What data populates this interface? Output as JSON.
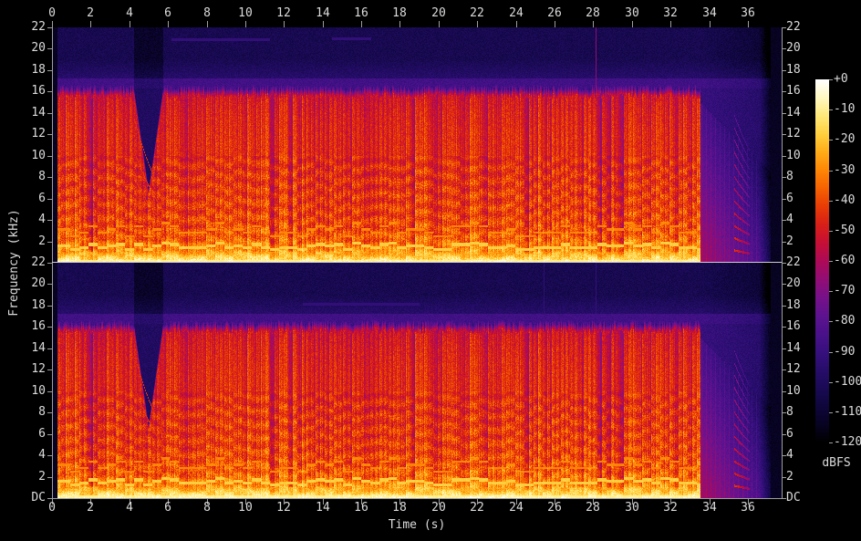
{
  "figure": {
    "xlabel": "Time (s)",
    "ylabel": "Frequency (kHz)",
    "colorbar_label": "dBFS",
    "background": "#000000",
    "axis_color": "#9e9e9e",
    "separator_color": "#cfcfcf",
    "text_color": "#dcdcdc"
  },
  "chart_data": {
    "type": "heatmap",
    "subtype": "audio-spectrogram-stereo",
    "channels": [
      "upper",
      "lower"
    ],
    "x": {
      "label": "Time (s)",
      "min": 0,
      "max": 37.75,
      "tick_values": [
        0,
        2,
        4,
        6,
        8,
        10,
        12,
        14,
        16,
        18,
        20,
        22,
        24,
        26,
        28,
        30,
        32,
        34,
        36
      ],
      "tick_labels": [
        "0",
        "2",
        "4",
        "6",
        "8",
        "10",
        "12",
        "14",
        "16",
        "18",
        "20",
        "22",
        "24",
        "26",
        "28",
        "30",
        "32",
        "34",
        "36"
      ]
    },
    "y": {
      "label": "Frequency (kHz)",
      "min": 0,
      "max": 22,
      "tick_values": [
        22,
        20,
        18,
        16,
        14,
        12,
        10,
        8,
        6,
        4,
        2
      ],
      "tick_labels": [
        "22",
        "20",
        "18",
        "16",
        "14",
        "12",
        "10",
        "8",
        "6",
        "4",
        "2"
      ],
      "dc_label": "DC"
    },
    "colorbar": {
      "label": "dBFS",
      "min": -120,
      "max": 0,
      "tick_labels": [
        "+0",
        "-10",
        "-20",
        "-30",
        "-40",
        "-50",
        "-60",
        "-70",
        "-80",
        "-90",
        "-100",
        "-110",
        "-120"
      ],
      "palette": [
        [
          -120,
          "#000000"
        ],
        [
          -114,
          "#070322"
        ],
        [
          -108,
          "#0f063c"
        ],
        [
          -102,
          "#1a0a55"
        ],
        [
          -96,
          "#270d6b"
        ],
        [
          -90,
          "#37107e"
        ],
        [
          -84,
          "#4a118a"
        ],
        [
          -78,
          "#5e128f"
        ],
        [
          -72,
          "#771189"
        ],
        [
          -66,
          "#920d74"
        ],
        [
          -60,
          "#ad0a56"
        ],
        [
          -54,
          "#c60f35"
        ],
        [
          -48,
          "#d81f17"
        ],
        [
          -42,
          "#e83b05"
        ],
        [
          -36,
          "#f66102"
        ],
        [
          -30,
          "#ff8605"
        ],
        [
          -24,
          "#ffab18"
        ],
        [
          -18,
          "#ffcf3e"
        ],
        [
          -12,
          "#ffe878"
        ],
        [
          -6,
          "#fff8c0"
        ],
        [
          0,
          "#ffffff"
        ]
      ]
    },
    "content": {
      "silence_lead_s": 0.28,
      "music_end_s": 33.55,
      "tail_end_s": 37.2,
      "duration_s": 37.75,
      "bandwidth_khz": 15.6,
      "noise_floor_db": -103,
      "noise_band": {
        "f0": 16.3,
        "f1": 17.2,
        "level_db": -87
      },
      "band_anchors": [
        [
          0,
          -8
        ],
        [
          0.25,
          -12
        ],
        [
          0.7,
          -20
        ],
        [
          1.2,
          -27
        ],
        [
          2,
          -33
        ],
        [
          3,
          -37
        ],
        [
          4.5,
          -40
        ],
        [
          6.5,
          -42
        ],
        [
          9,
          -44
        ],
        [
          12,
          -45
        ],
        [
          14,
          -47
        ],
        [
          15.6,
          -50
        ]
      ],
      "beat_period_s": 0.235,
      "melody": {
        "step_s": 0.47,
        "base_khz": 1.25,
        "range_khz": 0.6,
        "level_db": -16
      },
      "bass_level_db": -8,
      "notch": {
        "t0": 4.25,
        "t1": 5.75,
        "min_khz": 6.2,
        "arc_origins_khz": [
          13.5,
          10.5,
          8,
          6,
          4.6,
          3.4
        ],
        "arc_decay": 0.5,
        "arc_level_db": -44
      },
      "echo": {
        "level_db": -62,
        "tilt_db_per_khz": -1.6,
        "fade_db_per_s": -7
      },
      "resonant_tails": {
        "t0": 35.3,
        "t1": 36.1,
        "fundamental_khz": 1.15,
        "harmonics": 12,
        "level_db": -40
      },
      "channel_lines": {
        "upper": [
          {
            "t_s": 28.12,
            "level_db": -60
          }
        ],
        "lower": [
          {
            "t_s": 25.45,
            "level_db": -86
          },
          {
            "t_s": 28.12,
            "level_db": -84
          }
        ]
      },
      "hf_streaks": {
        "upper": [
          {
            "t0": 6.2,
            "t1": 11.3,
            "f_khz": 20.85
          },
          {
            "t0": 14.5,
            "t1": 16.5,
            "f_khz": 20.9
          }
        ],
        "lower": [
          {
            "t0": 13.0,
            "t1": 19.0,
            "f_khz": 18.1
          }
        ]
      }
    }
  }
}
